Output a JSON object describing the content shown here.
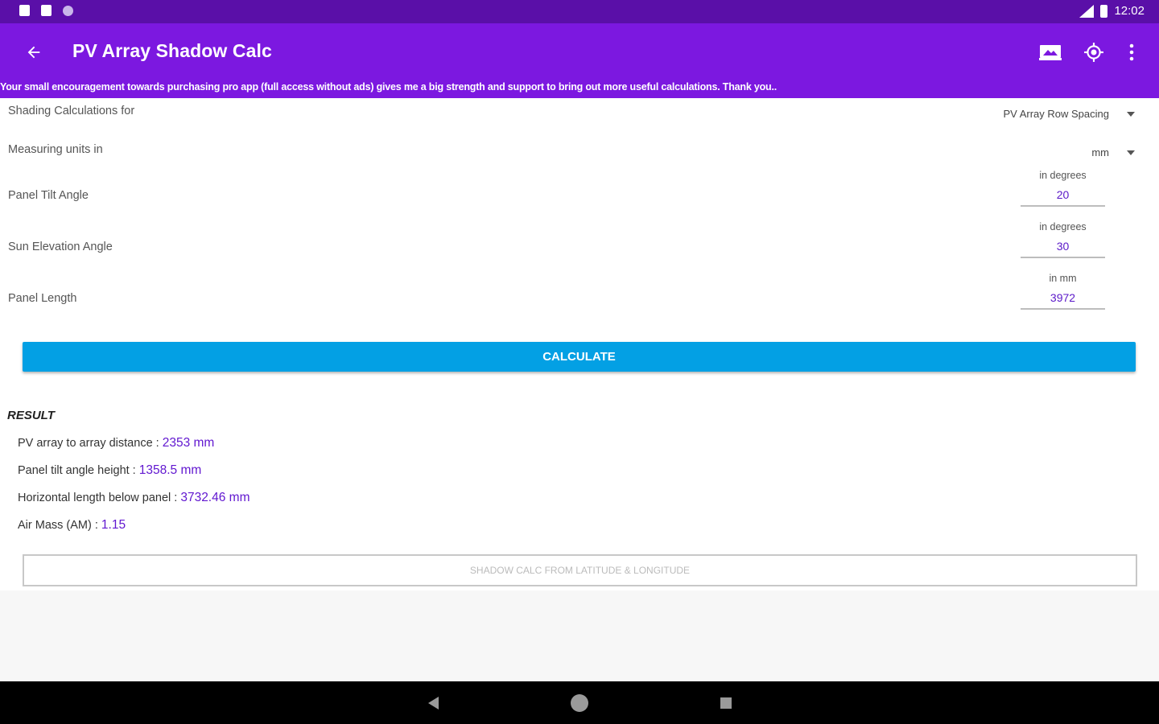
{
  "status_bar": {
    "time": "12:02",
    "icons": [
      "notification-icon",
      "sd-card-icon",
      "circle-icon",
      "signal-icon",
      "battery-icon"
    ]
  },
  "app_bar": {
    "title": "PV Array Shadow Calc",
    "banner": "Your small encouragement towards purchasing pro app (full access without ads) gives me a big strength and support to bring out more useful calculations. Thank you..",
    "actions": [
      "image-icon",
      "gps-target-icon",
      "more-vert-icon"
    ]
  },
  "form": {
    "shading_label": "Shading Calculations for",
    "shading_value": "PV Array Row Spacing",
    "units_label": "Measuring units in",
    "units_value": "mm",
    "tilt": {
      "label": "Panel Tilt Angle",
      "hint": "in degrees",
      "value": "20"
    },
    "sun": {
      "label": "Sun Elevation Angle",
      "hint": "in degrees",
      "value": "30"
    },
    "length": {
      "label": "Panel Length",
      "hint": "in mm",
      "value": "3972"
    }
  },
  "calculate_label": "CALCULATE",
  "result": {
    "heading": "RESULT",
    "items": [
      {
        "label": "PV array to array distance : ",
        "value": "2353 mm"
      },
      {
        "label": "Panel tilt angle height : ",
        "value": "1358.5 mm"
      },
      {
        "label": "Horizontal length below panel : ",
        "value": "3732.46 mm"
      },
      {
        "label": "Air Mass (AM) : ",
        "value": "1.15"
      }
    ]
  },
  "latlong_button": "SHADOW CALC FROM LATITUDE & LONGITUDE",
  "colors": {
    "status_bar": "#5a0fa8",
    "app_bar": "#7c18e0",
    "accent": "#6218d0",
    "calculate_button": "#03a0e4"
  }
}
